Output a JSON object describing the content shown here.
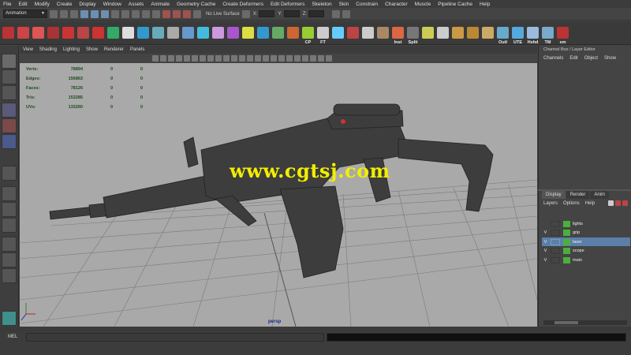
{
  "menu": [
    "File",
    "Edit",
    "Modify",
    "Create",
    "Display",
    "Window",
    "Assets",
    "Animate",
    "Geometry Cache",
    "Create Deformers",
    "Edit Deformers",
    "Skeleton",
    "Skin",
    "Constrain",
    "Character",
    "Muscle",
    "Pipeline Cache",
    "Help"
  ],
  "status_line": {
    "mode": "Animation",
    "live_surface": "No Live Surface",
    "coords": [
      "X:",
      "Y:",
      "Z:"
    ]
  },
  "shelf_labels": [
    "CP",
    "FT",
    "Inst",
    "Split",
    "Outl",
    "UTE",
    "Hshd",
    "TM",
    "sm"
  ],
  "viewport": {
    "menu": [
      "View",
      "Shading",
      "Lighting",
      "Show",
      "Renderer",
      "Panels"
    ],
    "hud": [
      {
        "label": "Verts:",
        "v1": "78894",
        "v2": "0",
        "v3": "0"
      },
      {
        "label": "Edges:",
        "v1": "156863",
        "v2": "0",
        "v3": "0"
      },
      {
        "label": "Faces:",
        "v1": "78126",
        "v2": "0",
        "v3": "0"
      },
      {
        "label": "Tris:",
        "v1": "153285",
        "v2": "0",
        "v3": "0"
      },
      {
        "label": "UVs:",
        "v1": "133260",
        "v2": "0",
        "v3": "0"
      }
    ],
    "watermark": "www.cgtsj.com",
    "camera": "persp"
  },
  "channel_box": {
    "title": "Channel Box / Layer Editor",
    "menu": [
      "Channels",
      "Edit",
      "Object",
      "Show"
    ]
  },
  "layer_editor": {
    "tabs": [
      "Display",
      "Render",
      "Anim"
    ],
    "menu": [
      "Layers",
      "Options",
      "Help"
    ],
    "layers": [
      {
        "vis": "",
        "name": "lights",
        "selected": false
      },
      {
        "vis": "V",
        "name": "grip",
        "selected": false
      },
      {
        "vis": "V",
        "name": "laser",
        "selected": true
      },
      {
        "vis": "V",
        "name": "scope",
        "selected": false
      },
      {
        "vis": "V",
        "name": "main",
        "selected": false
      }
    ]
  },
  "command_line": {
    "label": "MEL"
  },
  "colors": {
    "viewport_bg": "#a9a9a9",
    "watermark": "#f2ee00",
    "layer_swatch": "#4caf3c",
    "layer_selected": "#5b7fa8"
  }
}
